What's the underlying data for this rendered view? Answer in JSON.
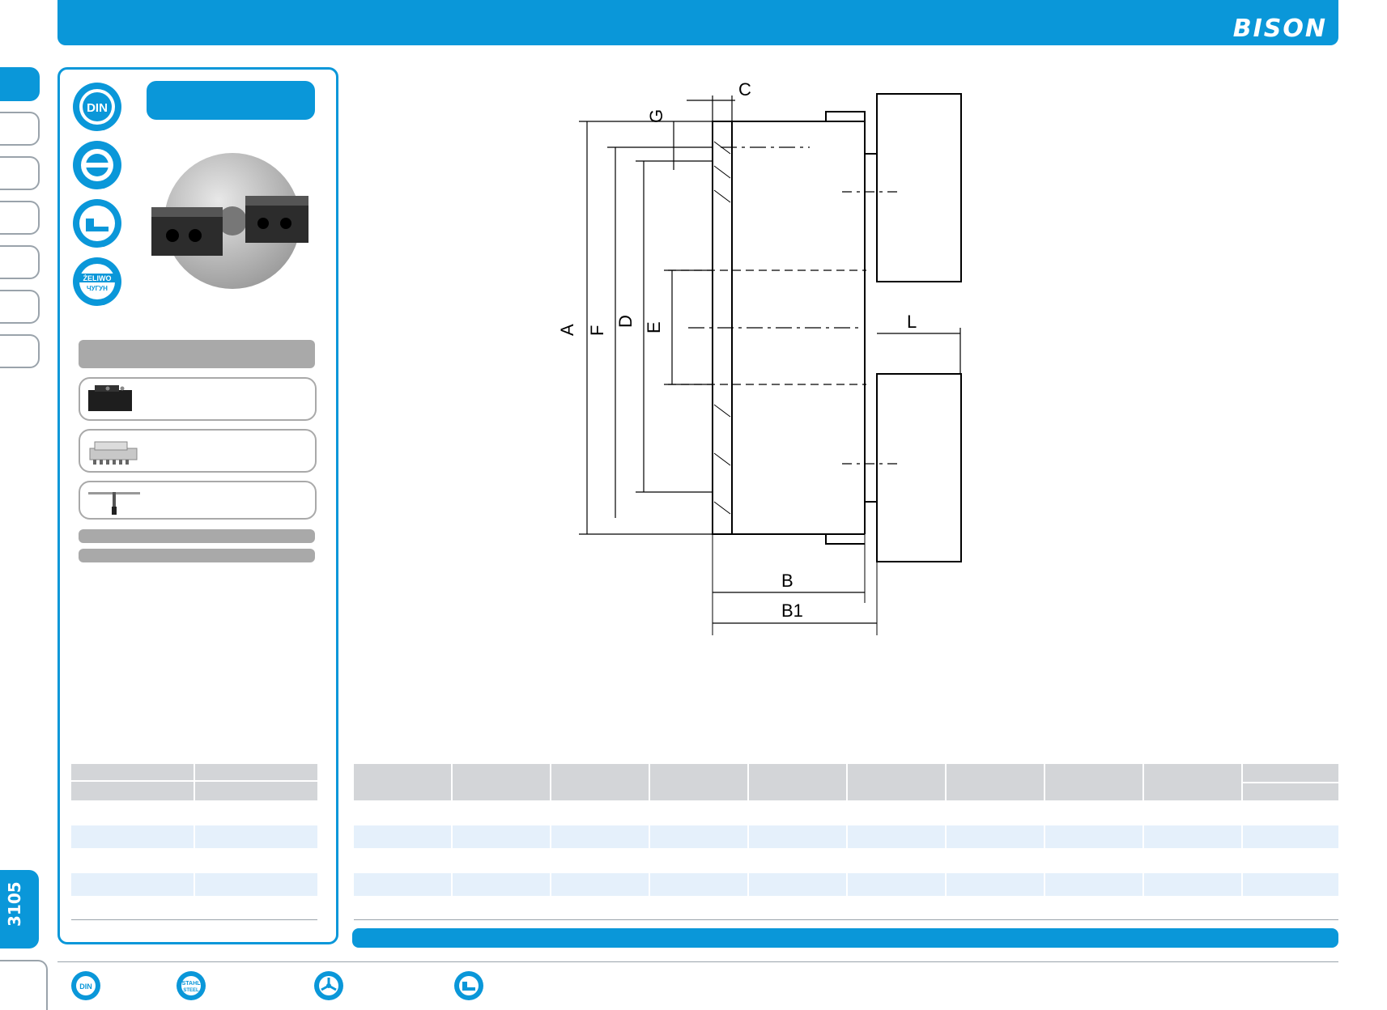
{
  "header": {
    "brand": "BISON"
  },
  "page": {
    "number": "3105"
  },
  "drawing": {
    "dimension_labels": [
      "A",
      "F",
      "D",
      "E",
      "C",
      "G",
      "L",
      "B",
      "B1"
    ]
  },
  "badges": {
    "side": [
      "DIN",
      "ŻELIWO",
      "ЧУГУН"
    ],
    "footer": [
      "DIN",
      "STAHL",
      "STEEL"
    ]
  },
  "colors": {
    "accent": "#0a97d9",
    "grey": "#a9a9a9",
    "header_fill": "#d3d5d8",
    "row_alt": "#e5f0fb"
  }
}
